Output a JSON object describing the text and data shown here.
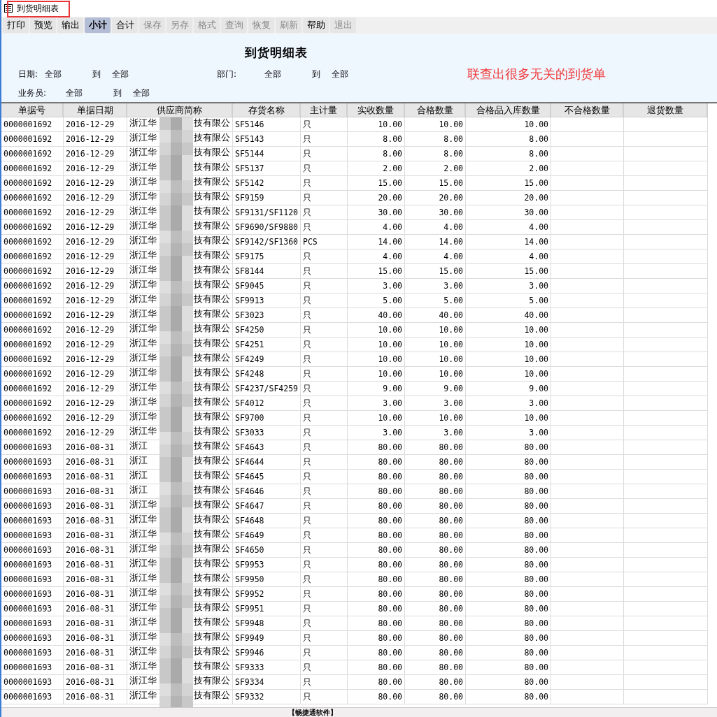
{
  "window": {
    "title": "到货明细表"
  },
  "toolbar": [
    {
      "label": "打印",
      "selected": false,
      "disabled": false
    },
    {
      "label": "预览",
      "selected": false,
      "disabled": false
    },
    {
      "label": "输出",
      "selected": false,
      "disabled": false
    },
    {
      "label": "小计",
      "selected": true,
      "disabled": false
    },
    {
      "label": "合计",
      "selected": false,
      "disabled": false
    },
    {
      "label": "保存",
      "selected": false,
      "disabled": true
    },
    {
      "label": "另存",
      "selected": false,
      "disabled": true
    },
    {
      "label": "格式",
      "selected": false,
      "disabled": true
    },
    {
      "label": "查询",
      "selected": false,
      "disabled": true
    },
    {
      "label": "恢复",
      "selected": false,
      "disabled": true
    },
    {
      "label": "刷新",
      "selected": false,
      "disabled": true
    },
    {
      "label": "帮助",
      "selected": false,
      "disabled": false
    },
    {
      "label": "退出",
      "selected": false,
      "disabled": true
    }
  ],
  "report": {
    "title": "到货明细表",
    "annotation": "联查出很多无关的到货单",
    "filters": [
      [
        {
          "label": "日期:",
          "from": "全部",
          "to_label": "到",
          "to": "全部"
        },
        {
          "label": "部门:",
          "from": "全部",
          "to_label": "到",
          "to": "全部"
        }
      ],
      [
        {
          "label": "业务员:",
          "from": "全部",
          "to_label": "到",
          "to": "全部"
        }
      ]
    ]
  },
  "table": {
    "columns": [
      "单据号",
      "单据日期",
      "供应商简称",
      "存货名称",
      "主计量",
      "实收数量",
      "合格数量",
      "合格品入库数量",
      "不合格数量",
      "退货数量"
    ],
    "rows": [
      {
        "doc": "0000001692",
        "date": "2016-12-29",
        "supplier_start": "浙江华",
        "supplier_end": "技有限公",
        "item": "SF5146",
        "unit": "只",
        "received": "10.00",
        "qualified": "10.00",
        "stored": "10.00"
      },
      {
        "doc": "0000001692",
        "date": "2016-12-29",
        "supplier_start": "浙江华",
        "supplier_end": "技有限公",
        "item": "SF5143",
        "unit": "只",
        "received": "8.00",
        "qualified": "8.00",
        "stored": "8.00"
      },
      {
        "doc": "0000001692",
        "date": "2016-12-29",
        "supplier_start": "浙江华",
        "supplier_end": "技有限公",
        "item": "SF5144",
        "unit": "只",
        "received": "8.00",
        "qualified": "8.00",
        "stored": "8.00"
      },
      {
        "doc": "0000001692",
        "date": "2016-12-29",
        "supplier_start": "浙江华",
        "supplier_end": "技有限公",
        "item": "SF5137",
        "unit": "只",
        "received": "2.00",
        "qualified": "2.00",
        "stored": "2.00"
      },
      {
        "doc": "0000001692",
        "date": "2016-12-29",
        "supplier_start": "浙江华",
        "supplier_end": "技有限公",
        "item": "SF5142",
        "unit": "只",
        "received": "15.00",
        "qualified": "15.00",
        "stored": "15.00"
      },
      {
        "doc": "0000001692",
        "date": "2016-12-29",
        "supplier_start": "浙江华",
        "supplier_end": "技有限公",
        "item": "SF9159",
        "unit": "只",
        "received": "20.00",
        "qualified": "20.00",
        "stored": "20.00"
      },
      {
        "doc": "0000001692",
        "date": "2016-12-29",
        "supplier_start": "浙江华",
        "supplier_end": "技有限公",
        "item": "SF9131/SF1120",
        "unit": "只",
        "received": "30.00",
        "qualified": "30.00",
        "stored": "30.00"
      },
      {
        "doc": "0000001692",
        "date": "2016-12-29",
        "supplier_start": "浙江华",
        "supplier_end": "技有限公",
        "item": "SF9690/SF9880",
        "unit": "只",
        "received": "4.00",
        "qualified": "4.00",
        "stored": "4.00"
      },
      {
        "doc": "0000001692",
        "date": "2016-12-29",
        "supplier_start": "浙江华",
        "supplier_end": "技有限公",
        "item": "SF9142/SF1360",
        "unit": "PCS",
        "received": "14.00",
        "qualified": "14.00",
        "stored": "14.00"
      },
      {
        "doc": "0000001692",
        "date": "2016-12-29",
        "supplier_start": "浙江华",
        "supplier_end": "技有限公",
        "item": "SF9175",
        "unit": "只",
        "received": "4.00",
        "qualified": "4.00",
        "stored": "4.00"
      },
      {
        "doc": "0000001692",
        "date": "2016-12-29",
        "supplier_start": "浙江华",
        "supplier_end": "技有限公",
        "item": "SF8144",
        "unit": "只",
        "received": "15.00",
        "qualified": "15.00",
        "stored": "15.00"
      },
      {
        "doc": "0000001692",
        "date": "2016-12-29",
        "supplier_start": "浙江华",
        "supplier_end": "技有限公",
        "item": "SF9045",
        "unit": "只",
        "received": "3.00",
        "qualified": "3.00",
        "stored": "3.00"
      },
      {
        "doc": "0000001692",
        "date": "2016-12-29",
        "supplier_start": "浙江华",
        "supplier_end": "技有限公",
        "item": "SF9913",
        "unit": "只",
        "received": "5.00",
        "qualified": "5.00",
        "stored": "5.00"
      },
      {
        "doc": "0000001692",
        "date": "2016-12-29",
        "supplier_start": "浙江华",
        "supplier_end": "技有限公",
        "item": "SF3023",
        "unit": "只",
        "received": "40.00",
        "qualified": "40.00",
        "stored": "40.00"
      },
      {
        "doc": "0000001692",
        "date": "2016-12-29",
        "supplier_start": "浙江华",
        "supplier_end": "技有限公",
        "item": "SF4250",
        "unit": "只",
        "received": "10.00",
        "qualified": "10.00",
        "stored": "10.00"
      },
      {
        "doc": "0000001692",
        "date": "2016-12-29",
        "supplier_start": "浙江华",
        "supplier_end": "技有限公",
        "item": "SF4251",
        "unit": "只",
        "received": "10.00",
        "qualified": "10.00",
        "stored": "10.00"
      },
      {
        "doc": "0000001692",
        "date": "2016-12-29",
        "supplier_start": "浙江华",
        "supplier_end": "技有限公",
        "item": "SF4249",
        "unit": "只",
        "received": "10.00",
        "qualified": "10.00",
        "stored": "10.00"
      },
      {
        "doc": "0000001692",
        "date": "2016-12-29",
        "supplier_start": "浙江华",
        "supplier_end": "技有限公",
        "item": "SF4248",
        "unit": "只",
        "received": "10.00",
        "qualified": "10.00",
        "stored": "10.00"
      },
      {
        "doc": "0000001692",
        "date": "2016-12-29",
        "supplier_start": "浙江华",
        "supplier_end": "技有限公",
        "item": "SF4237/SF4259",
        "unit": "只",
        "received": "9.00",
        "qualified": "9.00",
        "stored": "9.00"
      },
      {
        "doc": "0000001692",
        "date": "2016-12-29",
        "supplier_start": "浙江华",
        "supplier_end": "技有限公",
        "item": "SF4012",
        "unit": "只",
        "received": "3.00",
        "qualified": "3.00",
        "stored": "3.00"
      },
      {
        "doc": "0000001692",
        "date": "2016-12-29",
        "supplier_start": "浙江华",
        "supplier_end": "技有限公",
        "item": "SF9700",
        "unit": "只",
        "received": "10.00",
        "qualified": "10.00",
        "stored": "10.00"
      },
      {
        "doc": "0000001692",
        "date": "2016-12-29",
        "supplier_start": "浙江华",
        "supplier_end": "技有限公",
        "item": "SF3033",
        "unit": "只",
        "received": "3.00",
        "qualified": "3.00",
        "stored": "3.00"
      },
      {
        "doc": "0000001693",
        "date": "2016-08-31",
        "supplier_start": "浙江",
        "supplier_end": "技有限公",
        "item": "SF4643",
        "unit": "只",
        "received": "80.00",
        "qualified": "80.00",
        "stored": "80.00"
      },
      {
        "doc": "0000001693",
        "date": "2016-08-31",
        "supplier_start": "浙江",
        "supplier_end": "技有限公",
        "item": "SF4644",
        "unit": "只",
        "received": "80.00",
        "qualified": "80.00",
        "stored": "80.00"
      },
      {
        "doc": "0000001693",
        "date": "2016-08-31",
        "supplier_start": "浙江",
        "supplier_end": "技有限公",
        "item": "SF4645",
        "unit": "只",
        "received": "80.00",
        "qualified": "80.00",
        "stored": "80.00"
      },
      {
        "doc": "0000001693",
        "date": "2016-08-31",
        "supplier_start": "浙江",
        "supplier_end": "技有限公",
        "item": "SF4646",
        "unit": "只",
        "received": "80.00",
        "qualified": "80.00",
        "stored": "80.00"
      },
      {
        "doc": "0000001693",
        "date": "2016-08-31",
        "supplier_start": "浙江华",
        "supplier_end": "技有限公",
        "item": "SF4647",
        "unit": "只",
        "received": "80.00",
        "qualified": "80.00",
        "stored": "80.00"
      },
      {
        "doc": "0000001693",
        "date": "2016-08-31",
        "supplier_start": "浙江华",
        "supplier_end": "技有限公",
        "item": "SF4648",
        "unit": "只",
        "received": "80.00",
        "qualified": "80.00",
        "stored": "80.00"
      },
      {
        "doc": "0000001693",
        "date": "2016-08-31",
        "supplier_start": "浙江华",
        "supplier_end": "技有限公",
        "item": "SF4649",
        "unit": "只",
        "received": "80.00",
        "qualified": "80.00",
        "stored": "80.00"
      },
      {
        "doc": "0000001693",
        "date": "2016-08-31",
        "supplier_start": "浙江华",
        "supplier_end": "技有限公",
        "item": "SF4650",
        "unit": "只",
        "received": "80.00",
        "qualified": "80.00",
        "stored": "80.00"
      },
      {
        "doc": "0000001693",
        "date": "2016-08-31",
        "supplier_start": "浙江华",
        "supplier_end": "技有限公",
        "item": "SF9953",
        "unit": "只",
        "received": "80.00",
        "qualified": "80.00",
        "stored": "80.00"
      },
      {
        "doc": "0000001693",
        "date": "2016-08-31",
        "supplier_start": "浙江华",
        "supplier_end": "技有限公",
        "item": "SF9950",
        "unit": "只",
        "received": "80.00",
        "qualified": "80.00",
        "stored": "80.00"
      },
      {
        "doc": "0000001693",
        "date": "2016-08-31",
        "supplier_start": "浙江华",
        "supplier_end": "技有限公",
        "item": "SF9952",
        "unit": "只",
        "received": "80.00",
        "qualified": "80.00",
        "stored": "80.00"
      },
      {
        "doc": "0000001693",
        "date": "2016-08-31",
        "supplier_start": "浙江华",
        "supplier_end": "技有限公",
        "item": "SF9951",
        "unit": "只",
        "received": "80.00",
        "qualified": "80.00",
        "stored": "80.00"
      },
      {
        "doc": "0000001693",
        "date": "2016-08-31",
        "supplier_start": "浙江华",
        "supplier_end": "技有限公",
        "item": "SF9948",
        "unit": "只",
        "received": "80.00",
        "qualified": "80.00",
        "stored": "80.00"
      },
      {
        "doc": "0000001693",
        "date": "2016-08-31",
        "supplier_start": "浙江华",
        "supplier_end": "技有限公",
        "item": "SF9949",
        "unit": "只",
        "received": "80.00",
        "qualified": "80.00",
        "stored": "80.00"
      },
      {
        "doc": "0000001693",
        "date": "2016-08-31",
        "supplier_start": "浙江华",
        "supplier_end": "技有限公",
        "item": "SF9946",
        "unit": "只",
        "received": "80.00",
        "qualified": "80.00",
        "stored": "80.00"
      },
      {
        "doc": "0000001693",
        "date": "2016-08-31",
        "supplier_start": "浙江华",
        "supplier_end": "技有限公",
        "item": "SF9333",
        "unit": "只",
        "received": "80.00",
        "qualified": "80.00",
        "stored": "80.00"
      },
      {
        "doc": "0000001693",
        "date": "2016-08-31",
        "supplier_start": "浙江华",
        "supplier_end": "技有限公",
        "item": "SF9334",
        "unit": "只",
        "received": "80.00",
        "qualified": "80.00",
        "stored": "80.00"
      },
      {
        "doc": "0000001693",
        "date": "2016-08-31",
        "supplier_start": "浙江华",
        "supplier_end": "技有限公",
        "item": "SF9332",
        "unit": "只",
        "received": "80.00",
        "qualified": "80.00",
        "stored": "80.00"
      }
    ]
  },
  "status_bar": {
    "text": "【畅捷通软件】"
  }
}
